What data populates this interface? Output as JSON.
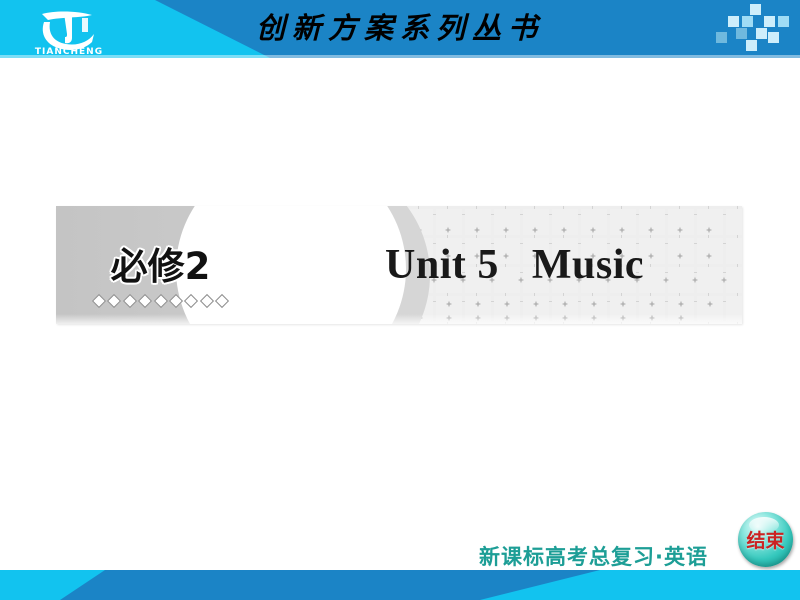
{
  "header": {
    "series_title": "创新方案系列丛书",
    "logo": {
      "name": "tiancheng-logo",
      "brand_text": "TIANCHENG"
    },
    "background_color": "#12c3ef",
    "wedge_color": "#1b84c6"
  },
  "banner": {
    "volume_label": "必修2",
    "unit_title": "Unit 5   Music",
    "diamond_count": 9,
    "background_color": "#eeeeee",
    "left_panel_color": "#c8c8c8"
  },
  "footer": {
    "subject_line": "新课标高考总复习·英语",
    "subject_color": "#1d9e96",
    "end_button_label": "结束",
    "end_button_text_color": "#cc2222",
    "bar_color": "#12c3ef",
    "bar_wedge_color": "#1b84c6"
  }
}
